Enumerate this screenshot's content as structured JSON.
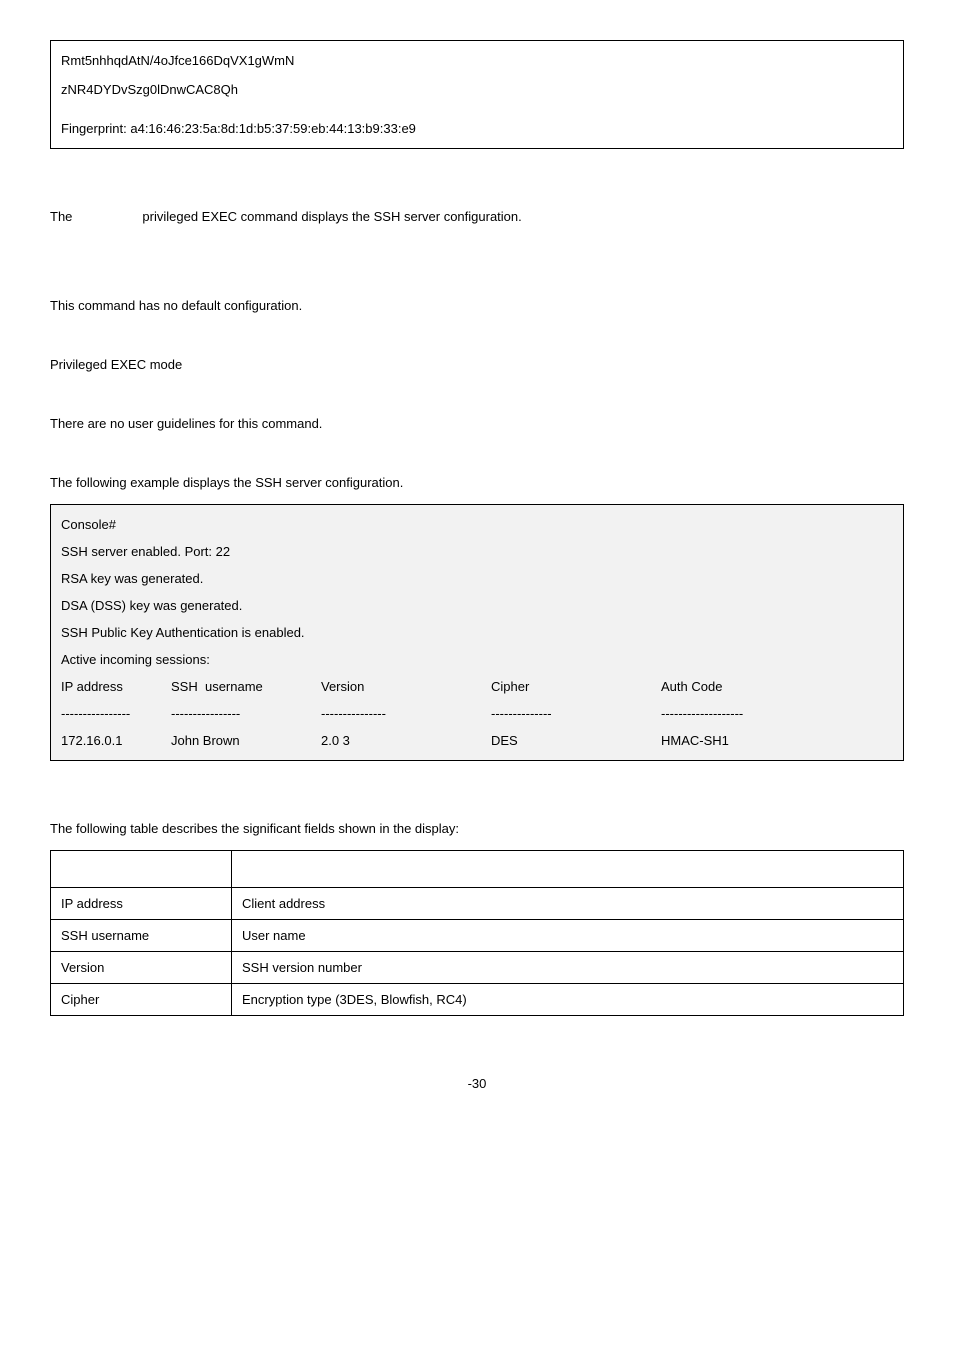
{
  "codebox": {
    "line1": "Rmt5nhhqdAtN/4oJfce166DqVX1gWmN",
    "line2": "zNR4DYDvSzg0lDnwCAC8Qh",
    "line3": "Fingerprint: a4:16:46:23:5a:8d:1d:b5:37:59:eb:44:13:b9:33:e9"
  },
  "intro": {
    "prefix": "The",
    "rest": "privileged EXEC command displays the SSH server configuration."
  },
  "default_cfg": "This command has no default configuration.",
  "mode": "Privileged EXEC mode",
  "guidelines": "There are no user guidelines for this command.",
  "example_intro": "The following example displays the SSH server configuration.",
  "example": {
    "prompt": "Console#",
    "l1": "SSH server enabled. Port: 22",
    "l2": "RSA key was generated.",
    "l3": "DSA (DSS) key was generated.",
    "l4": "SSH Public Key Authentication is enabled.",
    "l5": "Active incoming sessions:",
    "header": {
      "c1": "IP address",
      "c2a": "SSH",
      "c2b": "username",
      "c3": "Version",
      "c4": "Cipher",
      "c5": "Auth Code"
    },
    "dash": {
      "c1": "----------------",
      "c2": "----------------",
      "c3": "---------------",
      "c4": "--------------",
      "c5": "-------------------"
    },
    "row": {
      "c1": "172.16.0.1",
      "c2": "John Brown",
      "c3": "2.0 3",
      "c4": "DES",
      "c5": "HMAC-SH1"
    }
  },
  "table_intro": "The following table describes the significant fields shown in the display:",
  "table": {
    "rows": [
      {
        "f": "IP address",
        "d": "Client address"
      },
      {
        "f": "SSH username",
        "d": "User name"
      },
      {
        "f": "Version",
        "d": "SSH version number"
      },
      {
        "f": "Cipher",
        "d": "Encryption type (3DES, Blowfish, RC4)"
      }
    ]
  },
  "page": "-30"
}
